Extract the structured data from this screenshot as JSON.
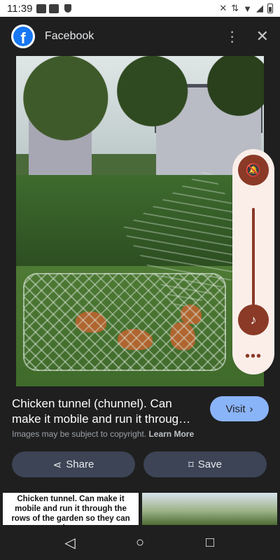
{
  "status_bar": {
    "time": "11:39"
  },
  "header": {
    "app_name": "Facebook",
    "more_icon": "more-vert-icon",
    "close_icon": "close-icon"
  },
  "result": {
    "title": "Chicken tunnel (chunnel). Can make it mobile and run it throug…",
    "copyright_text": "Images may be subject to copyright.",
    "learn_more": "Learn More",
    "visit_label": "Visit",
    "share_label": "Share",
    "save_label": "Save"
  },
  "related": [
    {
      "caption": "Chicken tunnel. Can make it mobile and run it through the rows of the garden so they can eat the pests"
    },
    {
      "caption": ""
    }
  ],
  "colors": {
    "accent": "#8ab4f8",
    "button_bg": "#3c4455",
    "volume": "#8a3a27",
    "panel": "#fbeee9"
  }
}
